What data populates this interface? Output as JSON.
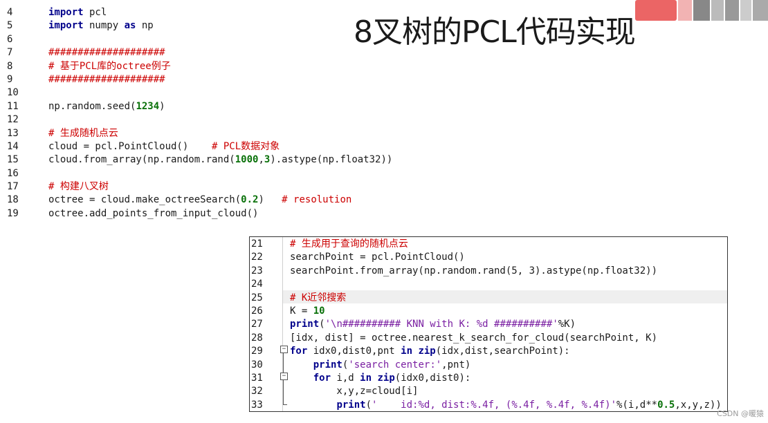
{
  "title": "8叉树的PCL代码实现",
  "watermark": "CSDN @暖猿",
  "top_code": [
    {
      "n": "4",
      "parts": [
        [
          "kw",
          "import"
        ],
        [
          "t",
          " pcl"
        ]
      ]
    },
    {
      "n": "5",
      "parts": [
        [
          "kw",
          "import"
        ],
        [
          "t",
          " numpy "
        ],
        [
          "kw",
          "as"
        ],
        [
          "t",
          " np"
        ]
      ]
    },
    {
      "n": "6",
      "parts": []
    },
    {
      "n": "7",
      "parts": [
        [
          "cm",
          "####################"
        ]
      ]
    },
    {
      "n": "8",
      "parts": [
        [
          "cm",
          "# 基于PCL库的octree例子"
        ]
      ]
    },
    {
      "n": "9",
      "parts": [
        [
          "cm",
          "####################"
        ]
      ]
    },
    {
      "n": "10",
      "parts": []
    },
    {
      "n": "11",
      "parts": [
        [
          "t",
          "np.random.seed("
        ],
        [
          "num",
          "1234"
        ],
        [
          "t",
          ")"
        ]
      ]
    },
    {
      "n": "12",
      "parts": []
    },
    {
      "n": "13",
      "parts": [
        [
          "cm",
          "# 生成随机点云"
        ]
      ]
    },
    {
      "n": "14",
      "parts": [
        [
          "t",
          "cloud = pcl.PointCloud()    "
        ],
        [
          "cm",
          "# PCL数据对象"
        ]
      ]
    },
    {
      "n": "15",
      "parts": [
        [
          "t",
          "cloud.from_array(np.random.rand("
        ],
        [
          "num",
          "1000"
        ],
        [
          "t",
          ","
        ],
        [
          "num",
          "3"
        ],
        [
          "t",
          ").astype(np.float32))"
        ]
      ]
    },
    {
      "n": "16",
      "parts": []
    },
    {
      "n": "17",
      "parts": [
        [
          "cm",
          "# 构建八叉树"
        ]
      ]
    },
    {
      "n": "18",
      "parts": [
        [
          "t",
          "octree = cloud.make_octreeSearch("
        ],
        [
          "num",
          "0.2"
        ],
        [
          "t",
          ")   "
        ],
        [
          "cm",
          "# resolution"
        ]
      ]
    },
    {
      "n": "19",
      "parts": [
        [
          "t",
          "octree.add_points_from_input_cloud()"
        ]
      ]
    }
  ],
  "box_code": [
    {
      "n": "21",
      "parts": [
        [
          "cm",
          "# 生成用于查询的随机点云"
        ]
      ]
    },
    {
      "n": "22",
      "parts": [
        [
          "t",
          "searchPoint = pcl.PointCloud()"
        ]
      ]
    },
    {
      "n": "23",
      "parts": [
        [
          "t",
          "searchPoint.from_array(np.random.rand(5, 3).astype(np.float32))"
        ]
      ]
    },
    {
      "n": "24",
      "parts": []
    },
    {
      "n": "25",
      "parts": [
        [
          "cm",
          "# K近邻搜索"
        ]
      ]
    },
    {
      "n": "26",
      "parts": [
        [
          "t",
          "K = "
        ],
        [
          "num",
          "10"
        ]
      ]
    },
    {
      "n": "27",
      "parts": [
        [
          "kw",
          "print"
        ],
        [
          "t",
          "("
        ],
        [
          "strb",
          "'\\n########## KNN with K: %d ##########'"
        ],
        [
          "t",
          "%K)"
        ]
      ]
    },
    {
      "n": "28",
      "parts": [
        [
          "t",
          "[idx, dist] = octree.nearest_k_search_for_cloud(searchPoint, K)"
        ]
      ]
    },
    {
      "n": "29",
      "parts": [
        [
          "kw",
          "for"
        ],
        [
          "t",
          " idx0,dist0,pnt "
        ],
        [
          "kw",
          "in"
        ],
        [
          "t",
          " "
        ],
        [
          "kw",
          "zip"
        ],
        [
          "t",
          "(idx,dist,searchPoint):"
        ]
      ]
    },
    {
      "n": "30",
      "parts": [
        [
          "t",
          "    "
        ],
        [
          "kw",
          "print"
        ],
        [
          "t",
          "("
        ],
        [
          "strb",
          "'search center:'"
        ],
        [
          "t",
          ",pnt)"
        ]
      ]
    },
    {
      "n": "31",
      "parts": [
        [
          "t",
          "    "
        ],
        [
          "kw",
          "for"
        ],
        [
          "t",
          " i,d "
        ],
        [
          "kw",
          "in"
        ],
        [
          "t",
          " "
        ],
        [
          "kw",
          "zip"
        ],
        [
          "t",
          "(idx0,dist0):"
        ]
      ]
    },
    {
      "n": "32",
      "parts": [
        [
          "t",
          "        x,y,z=cloud[i]"
        ]
      ]
    },
    {
      "n": "33",
      "parts": [
        [
          "t",
          "        "
        ],
        [
          "kw",
          "print"
        ],
        [
          "t",
          "("
        ],
        [
          "strb",
          "'    id:%d, dist:%.4f, (%.4f, %.4f, %.4f)'"
        ],
        [
          "t",
          "%(i,d**"
        ],
        [
          "num",
          "0.5"
        ],
        [
          "t",
          ",x,y,z))"
        ]
      ]
    }
  ],
  "highlight_line": "25",
  "colors": {
    "keyword": "#00008b",
    "comment": "#cc0000",
    "number": "#097109",
    "string": "#7a1fa2"
  }
}
